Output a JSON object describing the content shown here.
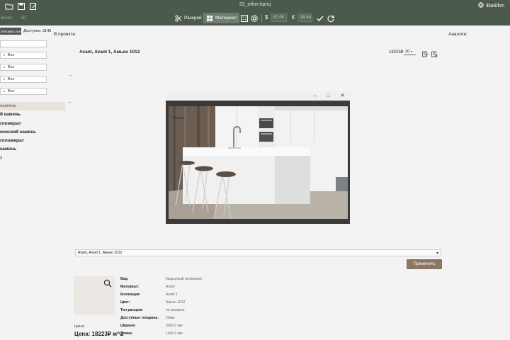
{
  "topbar": {
    "filename": "22_other.kproj",
    "user": "lika9/km",
    "view_tabs": [
      "Эскиз",
      "3D"
    ],
    "raskroi_label": "Раскрой",
    "material_label": "Материал",
    "usd_value": "87.00",
    "eur_value": "99.45",
    "usd_symbol": "$",
    "eur_symbol": "€"
  },
  "left_panel": {
    "tooltip": "Обновить все",
    "available": "Доступно: 3145",
    "filters": [
      "",
      "Все",
      "Все",
      "Все",
      "Все"
    ],
    "in_project": "В проекте:",
    "categories": [
      {
        "label": "камень",
        "selected": true
      },
      {
        "label": "й камень",
        "selected": false
      },
      {
        "label": "гломерат",
        "selected": false
      },
      {
        "label": "ический камень",
        "selected": false
      },
      {
        "label": "глломерат",
        "selected": false
      },
      {
        "label": "камень",
        "selected": false
      },
      {
        "label": "т",
        "selected": false
      }
    ]
  },
  "main": {
    "product_name": "Avant, Avant  1, Амьен 1012",
    "price": "18223₽",
    "qty": "20",
    "analogs": "Аналоги:"
  },
  "modal": {
    "image_label": "2 Амьен"
  },
  "bottom": {
    "select_value": "Avant, Avant  1, Амьен 1012",
    "apply_label": "Применить",
    "price_label": "Цена:",
    "price_value": "Цена: 18223₽ м^2",
    "props": [
      {
        "k": "Вид:",
        "v": "Кварцевый агломерат"
      },
      {
        "k": "Материал:",
        "v": "Avant"
      },
      {
        "k": "Коллекция:",
        "v": "Avant  1"
      },
      {
        "k": "Цвет:",
        "v": "Амьен 1012"
      },
      {
        "k": "Тип раскроя:",
        "v": "по раскрою"
      },
      {
        "k": "Доступные толщины:",
        "v": "20мм"
      },
      {
        "k": "Ширина:",
        "v": "3050.0 мм"
      },
      {
        "k": "Длина:",
        "v": "1440.0 мм"
      }
    ]
  }
}
